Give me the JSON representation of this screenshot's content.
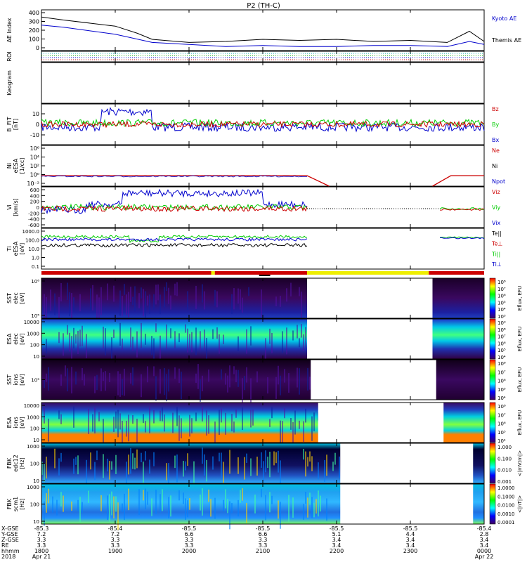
{
  "title": "P2 (TH-C)",
  "chart_data": {
    "type": "line",
    "title": "P2 (TH-C)",
    "x_time_labels": [
      "1800",
      "1900",
      "2000",
      "2100",
      "2200",
      "2300",
      "0000"
    ],
    "x_dates": {
      "first": "Apr 21",
      "last": "Apr 22"
    },
    "x_year": "2018",
    "ephemeris": {
      "row_labels": [
        "X-GSE",
        "Y-GSE",
        "Z-GSE",
        "RE",
        "hhmm",
        "2018"
      ],
      "columns": [
        [
          "-85.3",
          "7.2",
          "3.3",
          "3.3",
          "1800",
          "Apr 21"
        ],
        [
          "-85.4",
          "7.2",
          "3.3",
          "3.3",
          "1900",
          ""
        ],
        [
          "-85.5",
          "6.6",
          "3.3",
          "3.3",
          "2000",
          ""
        ],
        [
          "-85.5",
          "6.6",
          "3.3",
          "3.3",
          "2100",
          ""
        ],
        [
          "-85.5",
          "5.1",
          "3.4",
          "3.4",
          "2200",
          ""
        ],
        [
          "-85.5",
          "4.4",
          "3.4",
          "3.4",
          "2300",
          ""
        ],
        [
          "-85.4",
          "2.8",
          "3.4",
          "3.4",
          "0000",
          "Apr 22"
        ]
      ]
    },
    "panels": {
      "ae": {
        "ylabel": "AE Index",
        "ylim": [
          0,
          400
        ],
        "yticks": [
          "400",
          "300",
          "200",
          "100",
          "0"
        ],
        "legend": [
          "Kyoto AE",
          "Themis AE"
        ],
        "series": [
          {
            "name": "Kyoto AE",
            "color": "#0000cc",
            "x": [
              0,
              0.3,
              1,
              1.5,
              2,
              2.5,
              3,
              3.5,
              4,
              4.5,
              5,
              5.5,
              5.8,
              6
            ],
            "values": [
              250,
              230,
              160,
              80,
              60,
              40,
              50,
              40,
              40,
              50,
              50,
              40,
              90,
              60
            ]
          },
          {
            "name": "Themis AE",
            "color": "#000000",
            "x": [
              0,
              0.3,
              1,
              1.3,
              1.5,
              2,
              2.5,
              3,
              3.5,
              4,
              4.5,
              5,
              5.5,
              5.8,
              6
            ],
            "values": [
              330,
              300,
              240,
              170,
              110,
              80,
              90,
              110,
              100,
              110,
              90,
              100,
              80,
              190,
              90
            ]
          }
        ]
      },
      "roi": {
        "ylabel": "ROI"
      },
      "keogram": {
        "ylabel": "Keogram"
      },
      "bfield": {
        "ylabel": "B_FIT",
        "unit": "[nT]",
        "yticks": [
          "10",
          "0",
          "-10"
        ],
        "ylim": [
          -15,
          15
        ],
        "legend": [
          "Bz",
          "By",
          "Bx"
        ],
        "colors": {
          "Bz": "#cc0000",
          "By": "#00cc00",
          "Bx": "#0000cc"
        }
      },
      "density": {
        "ylabel": "Ni",
        "sublabel": "eESA",
        "unit": "[1/cc]",
        "yticks": [
          "10⁶",
          "10⁴",
          "10²",
          "10⁰",
          "10⁻²"
        ],
        "legend": [
          "Ne",
          "Ni",
          "Npot"
        ]
      },
      "velocity": {
        "ylabel": "Vi",
        "unit": "[km/s]",
        "yticks": [
          "600",
          "400",
          "200",
          "0",
          "-200",
          "-400",
          "-600"
        ],
        "ylim": [
          -600,
          600
        ],
        "legend": [
          "Viz",
          "Viy",
          "Vix"
        ]
      },
      "temperature": {
        "ylabel": "Ti",
        "sublabel": "eESA",
        "unit": "[eV]",
        "yticks": [
          "1000.0",
          "100.0",
          "10.0",
          "1.0",
          "0.1"
        ],
        "legend": [
          "Te||",
          "Te⊥",
          "Ti||",
          "Ti⊥"
        ]
      },
      "mode_bar": {
        "segments": [
          {
            "from": 0,
            "to": 2.3,
            "color": "#cc0000"
          },
          {
            "from": 2.3,
            "to": 2.35,
            "color": "#eeee00"
          },
          {
            "from": 2.35,
            "to": 3.6,
            "color": "#cc0000"
          },
          {
            "from": 3.6,
            "to": 5.25,
            "color": "#eeee00"
          },
          {
            "from": 5.25,
            "to": 6,
            "color": "#cc0000"
          }
        ]
      },
      "sst_e": {
        "ylabel": "SST",
        "sublabel": "elec",
        "unit": "[eV]",
        "yticks": [
          "10⁶",
          "10⁵"
        ],
        "gap": [
          3.6,
          5.3
        ]
      },
      "esa_e": {
        "ylabel": "ESA",
        "sublabel": "elec",
        "unit": "[eV]",
        "yticks": [
          "10000",
          "1000",
          "100",
          "10"
        ],
        "gap": [
          3.6,
          5.3
        ]
      },
      "sst_i": {
        "ylabel": "SST",
        "sublabel": "ions",
        "unit": "[eV]",
        "yticks": [
          "10⁵"
        ],
        "gap": [
          3.65,
          5.35
        ]
      },
      "esa_i": {
        "ylabel": "ESA",
        "sublabel": "ions",
        "unit": "[eV]",
        "yticks": [
          "10000",
          "1000",
          "100",
          "10"
        ],
        "gap": [
          3.75,
          5.45
        ]
      },
      "fbk_e": {
        "ylabel": "FBK",
        "sublabel": "edc12",
        "unit": "[Hz]",
        "yticks": [
          "1000",
          "100",
          "10"
        ],
        "gap": [
          4.05,
          5.85
        ]
      },
      "fbk_b": {
        "ylabel": "FBK",
        "sublabel": "scm1",
        "unit": "[Hz]",
        "yticks": [
          "1000",
          "100",
          "10"
        ],
        "gap": [
          4.05,
          5.85
        ]
      }
    },
    "colorbars": [
      {
        "label": "Eflux, EFU",
        "ticks": [
          "10⁸",
          "10⁷",
          "10⁶",
          "10⁵",
          "10⁴",
          "10³"
        ],
        "colors": [
          "#ff0000",
          "#ffff00",
          "#00ff00",
          "#00ffff",
          "#0000ff",
          "#400060"
        ]
      },
      {
        "label": "Eflux, EFU",
        "ticks": [
          "10⁹",
          "10⁸",
          "10⁷",
          "10⁶",
          "10⁵",
          "10⁴"
        ],
        "colors": [
          "#ff0000",
          "#ffff00",
          "#00ff00",
          "#00ffff",
          "#0000ff",
          "#400060"
        ]
      },
      {
        "label": "Eflux, EFU",
        "ticks": [
          "10⁸",
          "10⁷",
          "10⁶",
          "10⁵",
          "10⁴"
        ],
        "colors": [
          "#ff0000",
          "#ffff00",
          "#00ff00",
          "#00ffff",
          "#0000ff",
          "#400060"
        ]
      },
      {
        "label": "Eflux, EFU",
        "ticks": [
          "10⁸",
          "10⁷",
          "10⁶",
          "10⁵",
          "10⁴"
        ],
        "colors": [
          "#ff0000",
          "#ffff00",
          "#00ff00",
          "#00ffff",
          "#0000ff",
          "#400060"
        ]
      },
      {
        "label": "<|mV/m|>",
        "ticks": [
          "1.000",
          "0.100",
          "0.010",
          "0.001"
        ],
        "colors": [
          "#ff0000",
          "#ffff00",
          "#00ff00",
          "#00ffff",
          "#0000ff",
          "#400060"
        ]
      },
      {
        "label": "<|nT|>",
        "ticks": [
          "1.0000",
          "0.1000",
          "0.0100",
          "0.0010",
          "0.0001"
        ],
        "colors": [
          "#ff0000",
          "#ffff00",
          "#00ff00",
          "#00ffff",
          "#0000ff",
          "#400060"
        ]
      }
    ]
  }
}
